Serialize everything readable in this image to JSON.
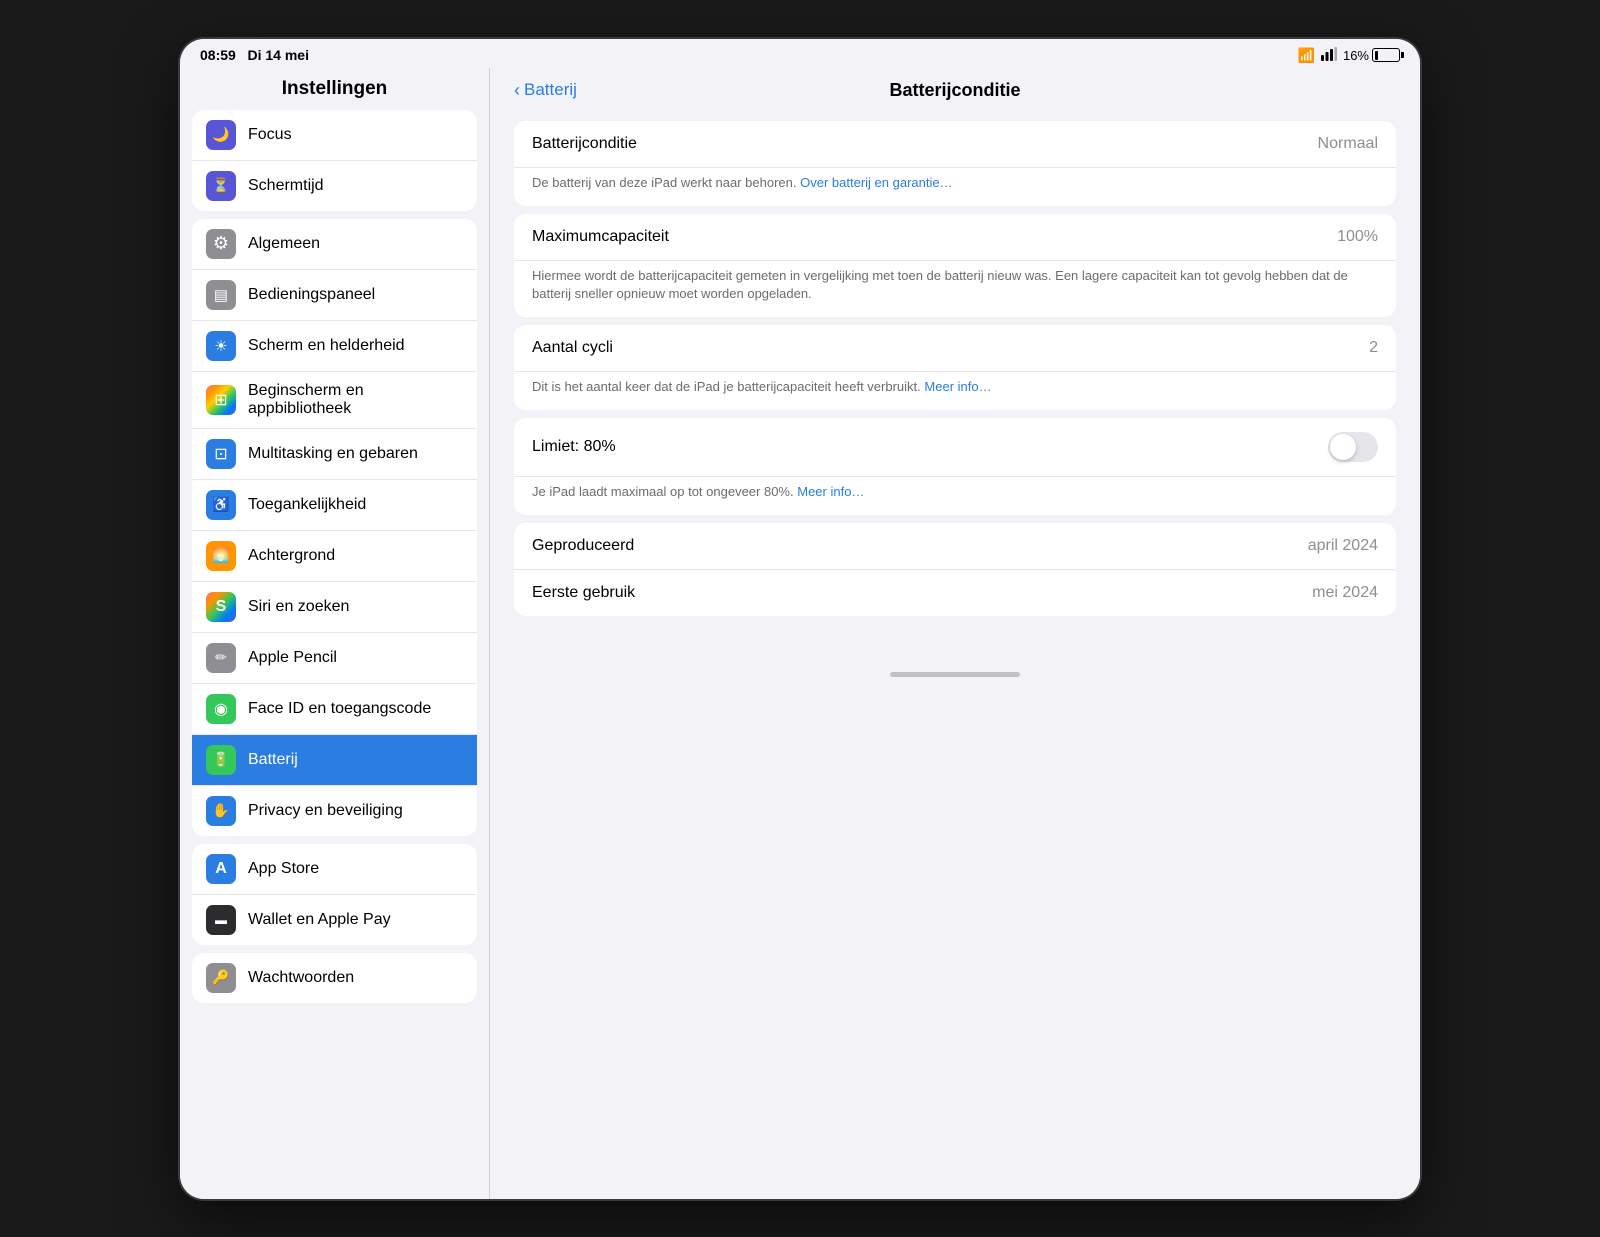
{
  "statusBar": {
    "time": "08:59",
    "date": "Di 14 mei",
    "batteryPercent": "16%",
    "batteryLevel": 16
  },
  "sidebar": {
    "title": "Instellingen",
    "sections": [
      {
        "id": "section1",
        "items": [
          {
            "id": "focus",
            "label": "Focus",
            "iconClass": "icon-focus",
            "iconInner": "icon-moon"
          },
          {
            "id": "schermtijd",
            "label": "Schermtijd",
            "iconClass": "icon-screentime",
            "iconInner": "icon-hourglass"
          }
        ]
      },
      {
        "id": "section2",
        "items": [
          {
            "id": "algemeen",
            "label": "Algemeen",
            "iconClass": "icon-general",
            "iconInner": "icon-gear"
          },
          {
            "id": "bedieningspaneel",
            "label": "Bedieningspaneel",
            "iconClass": "icon-control",
            "iconInner": "icon-sliders"
          },
          {
            "id": "scherm",
            "label": "Scherm en helderheid",
            "iconClass": "icon-display",
            "iconInner": "icon-sun"
          },
          {
            "id": "beginscherm",
            "label": "Beginscherm en appbibliotheek",
            "iconClass": "icon-homescreen",
            "iconInner": "icon-home"
          },
          {
            "id": "multitasking",
            "label": "Multitasking en gebaren",
            "iconClass": "icon-multitask",
            "iconInner": "icon-multi"
          },
          {
            "id": "toegankelijkheid",
            "label": "Toegankelijkheid",
            "iconClass": "icon-accessibility",
            "iconInner": "icon-a11y"
          },
          {
            "id": "achtergrond",
            "label": "Achtergrond",
            "iconClass": "icon-wallpaper",
            "iconInner": "icon-wp"
          },
          {
            "id": "siri",
            "label": "Siri en zoeken",
            "iconClass": "icon-siri",
            "iconInner": "icon-siri-s"
          },
          {
            "id": "applepencil",
            "label": "Apple Pencil",
            "iconClass": "icon-pencil",
            "iconInner": "icon-pencil-s"
          },
          {
            "id": "faceid",
            "label": "Face ID en toegangscode",
            "iconClass": "icon-faceid",
            "iconInner": "icon-face"
          },
          {
            "id": "batterij",
            "label": "Batterij",
            "iconClass": "icon-battery",
            "iconInner": "icon-batt",
            "active": true
          },
          {
            "id": "privacy",
            "label": "Privacy en beveiliging",
            "iconClass": "icon-privacy",
            "iconInner": "icon-priv"
          }
        ]
      },
      {
        "id": "section3",
        "items": [
          {
            "id": "appstore",
            "label": "App Store",
            "iconClass": "icon-appstore",
            "iconInner": "icon-apps"
          },
          {
            "id": "wallet",
            "label": "Wallet en Apple Pay",
            "iconClass": "icon-wallet",
            "iconInner": "icon-wal"
          }
        ]
      },
      {
        "id": "section4",
        "items": [
          {
            "id": "wachtwoorden",
            "label": "Wachtwoorden",
            "iconClass": "icon-passwords",
            "iconInner": "icon-pass"
          }
        ]
      }
    ]
  },
  "detailPanel": {
    "backLabel": "Batterij",
    "title": "Batterijconditie",
    "cards": [
      {
        "id": "conditie-card",
        "rows": [
          {
            "label": "Batterijconditie",
            "value": "Normaal"
          }
        ],
        "description": "De batterij van deze iPad werkt naar behoren.",
        "descriptionLink": "Over batterij en garantie…",
        "descriptionLinkHref": "#"
      },
      {
        "id": "capaciteit-card",
        "rows": [
          {
            "label": "Maximumcapaciteit",
            "value": "100%"
          }
        ],
        "description": "Hiermee wordt de batterijcapaciteit gemeten in vergelijking met toen de batterij nieuw was. Een lagere capaciteit kan tot gevolg hebben dat de batterij sneller opnieuw moet worden opgeladen.",
        "descriptionLink": null
      },
      {
        "id": "cycli-card",
        "rows": [
          {
            "label": "Aantal cycli",
            "value": "2"
          }
        ],
        "description": "Dit is het aantal keer dat de iPad je batterijcapaciteit heeft verbruikt.",
        "descriptionLink": "Meer info…",
        "descriptionLinkHref": "#"
      },
      {
        "id": "limiet-card",
        "rows": [
          {
            "label": "Limiet: 80%",
            "value": "",
            "toggle": true
          }
        ],
        "description": "Je iPad laadt maximaal op tot ongeveer 80%.",
        "descriptionLink": "Meer info…",
        "descriptionLinkHref": "#"
      },
      {
        "id": "info-card",
        "rows": [
          {
            "label": "Geproduceerd",
            "value": "april 2024"
          },
          {
            "label": "Eerste gebruik",
            "value": "mei 2024"
          }
        ],
        "description": null
      }
    ]
  }
}
